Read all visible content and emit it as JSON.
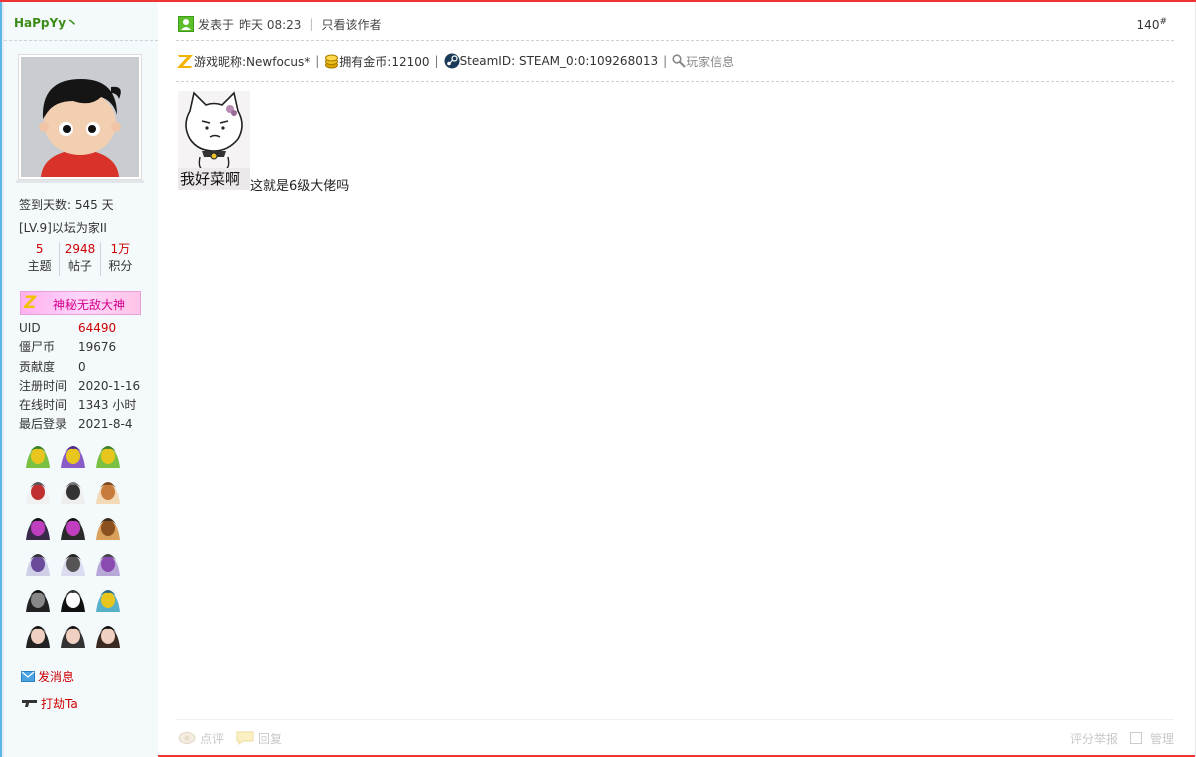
{
  "author": {
    "name": "HaPpYy丶",
    "checkin": "签到天数: 545 天",
    "level": "[LV.9]以坛为家II",
    "counts": [
      {
        "num": "5",
        "label": "主题"
      },
      {
        "num": "2948",
        "label": "帖子"
      },
      {
        "num": "1万",
        "label": "积分"
      }
    ],
    "rank_badge": "神秘无敌大神",
    "rank_badge_letter": "Z",
    "profile": [
      {
        "key": "UID",
        "value": "64490"
      },
      {
        "key": "僵尸币",
        "value": "19676"
      },
      {
        "key": "贡献度",
        "value": "0"
      },
      {
        "key": "注册时间",
        "value": "2020-1-16"
      },
      {
        "key": "在线时间",
        "value": "1343 小时"
      },
      {
        "key": "最后登录",
        "value": "2021-8-4"
      }
    ],
    "send_message": "发消息",
    "rob": "打劫Ta"
  },
  "post": {
    "posted_prefix": "发表于",
    "posted_time": "昨天 08:23",
    "only_author": "只看该作者",
    "floor": "140",
    "floor_mark": "#",
    "game_nickname": "游戏昵称:Newfocus*",
    "gold": "拥有金币:12100",
    "steam_id": "SteamID: STEAM_0:0:109268013",
    "player_info": "玩家信息",
    "sticker_caption": "我好菜啊",
    "text": "这就是6级大佬吗"
  },
  "footer": {
    "comment": "点评",
    "reply": "回复",
    "rate": "评分",
    "report": "举报",
    "manage": "管理"
  },
  "colors": {
    "accent_red": "#ee3333",
    "name_green": "#3c8c18",
    "value_red": "#cc0000",
    "side_bg": "#f4f9fc",
    "side_border_blue": "#5ab8e6"
  }
}
